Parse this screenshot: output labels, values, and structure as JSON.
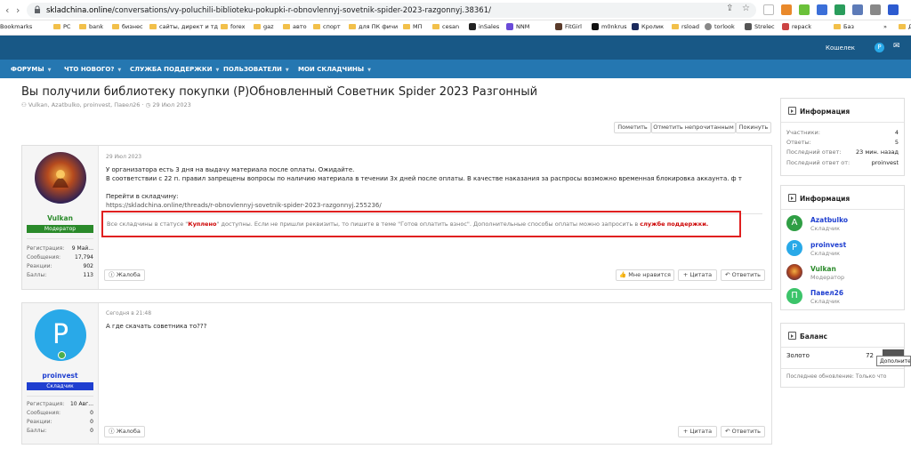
{
  "browser": {
    "url_domain": "skladchina.online",
    "url_path": "/conversations/vy-poluchili-biblioteku-pokupki-r-obnovlennyj-sovetnik-spider-2023-razgonnyj.38361/",
    "bookmarks": [
      "Bookmarks",
      "PC",
      "bank",
      "бизнес",
      "сайты, директ и тд",
      "forex",
      "gaz",
      "авто",
      "спорт",
      "для ПК фичи",
      "МП",
      "cesan",
      "inSales",
      "NNM",
      "FitGirl",
      "m0nkrus",
      "Кролик",
      "rsload",
      "torlook",
      "Strelec",
      "repack",
      "Баз",
      "»",
      "Д"
    ]
  },
  "header": {
    "wallet_label": "Кошелек",
    "wallet_badge": "P",
    "nav": [
      "ФОРУМЫ",
      "ЧТО НОВОГО?",
      "СЛУЖБА ПОДДЕРЖКИ",
      "ПОЛЬЗОВАТЕЛИ",
      "МОИ СКЛАДЧИНЫ"
    ]
  },
  "thread": {
    "title": "Вы получили библиотеку покупки (Р)Обновленный Советник Spider 2023 Разгонный",
    "participants": "Vulkan, Azatbulko, proinvest, Павел26",
    "date": "29 Июл 2023",
    "actions": [
      "Пометить",
      "Отметить непрочитанным",
      "Покинуть"
    ]
  },
  "posts": [
    {
      "author": "Vulkan",
      "role": "Модератор",
      "stats": [
        {
          "label": "Регистрация:",
          "value": "9 Май..."
        },
        {
          "label": "Сообщения:",
          "value": "17,794"
        },
        {
          "label": "Реакции:",
          "value": "902"
        },
        {
          "label": "Баллы:",
          "value": "113"
        }
      ],
      "date": "29 Июл 2023",
      "line1": "У организатора есть 3 дня на выдачу материала после оплаты. Ожидайте.",
      "line2": "В соответствии с 22 п. правил запрещены вопросы по наличию материала в течении 3х дней после оплаты. В качестве наказания за распросы возможно временная блокировка аккаунта. ф т",
      "line3": "Перейти в складчину:",
      "link": "https://skladchina.online/threads/r-obnovlennyj-sovetnik-spider-2023-razgonnyj.255236/",
      "notice_1": "Все складчины в статусе \"",
      "notice_bold": "Куплено",
      "notice_2": "\" доступны. Если не пришли реквизиты, то пишите в теме \"Готов оплатить взнос\". Дополнительные способы оплаты можно запросить в ",
      "notice_link": "службе поддержки.",
      "report": "Жалоба",
      "like": "Мне нравится",
      "quote": "+ Цитата",
      "reply": "Ответить"
    },
    {
      "author": "proinvest",
      "avatar_letter": "P",
      "role": "Складчик",
      "stats": [
        {
          "label": "Регистрация:",
          "value": "10 Авг..."
        },
        {
          "label": "Сообщения:",
          "value": "0"
        },
        {
          "label": "Реакции:",
          "value": "0"
        },
        {
          "label": "Баллы:",
          "value": "0"
        }
      ],
      "date": "Сегодня в 21:48",
      "text": "А где скачать советника то???",
      "report": "Жалоба",
      "quote": "+ Цитата",
      "reply": "Ответить"
    }
  ],
  "sidebar": {
    "info1": {
      "title": "Информация",
      "rows": [
        {
          "label": "Участники:",
          "value": "4"
        },
        {
          "label": "Ответы:",
          "value": "5"
        },
        {
          "label": "Последний ответ:",
          "value": "23 мин. назад"
        },
        {
          "label": "Последний ответ от:",
          "value": "proinvest"
        }
      ]
    },
    "info2": {
      "title": "Информация",
      "members": [
        {
          "name": "Azatbulko",
          "role": "Складчик",
          "letter": "A",
          "color": "#2f9e44"
        },
        {
          "name": "proinvest",
          "role": "Складчик",
          "letter": "P",
          "color": "#29a9e8"
        },
        {
          "name": "Vulkan",
          "role": "Модератор",
          "letter": "",
          "color": "#3a2a5e"
        },
        {
          "name": "Павел26",
          "role": "Складчик",
          "letter": "П",
          "color": "#3cc46a"
        }
      ]
    },
    "balance": {
      "title": "Баланс",
      "label": "Золото",
      "value": "72",
      "tooltip": "Дополните",
      "updated": "Последнее обновление: Только что"
    }
  },
  "colors": {
    "header_dark": "#185886",
    "header_light": "#2577b1",
    "moderator": "#2a8a2a",
    "member": "#1f3fd0",
    "notice_border": "#e02020",
    "link_red": "#cc0000"
  }
}
